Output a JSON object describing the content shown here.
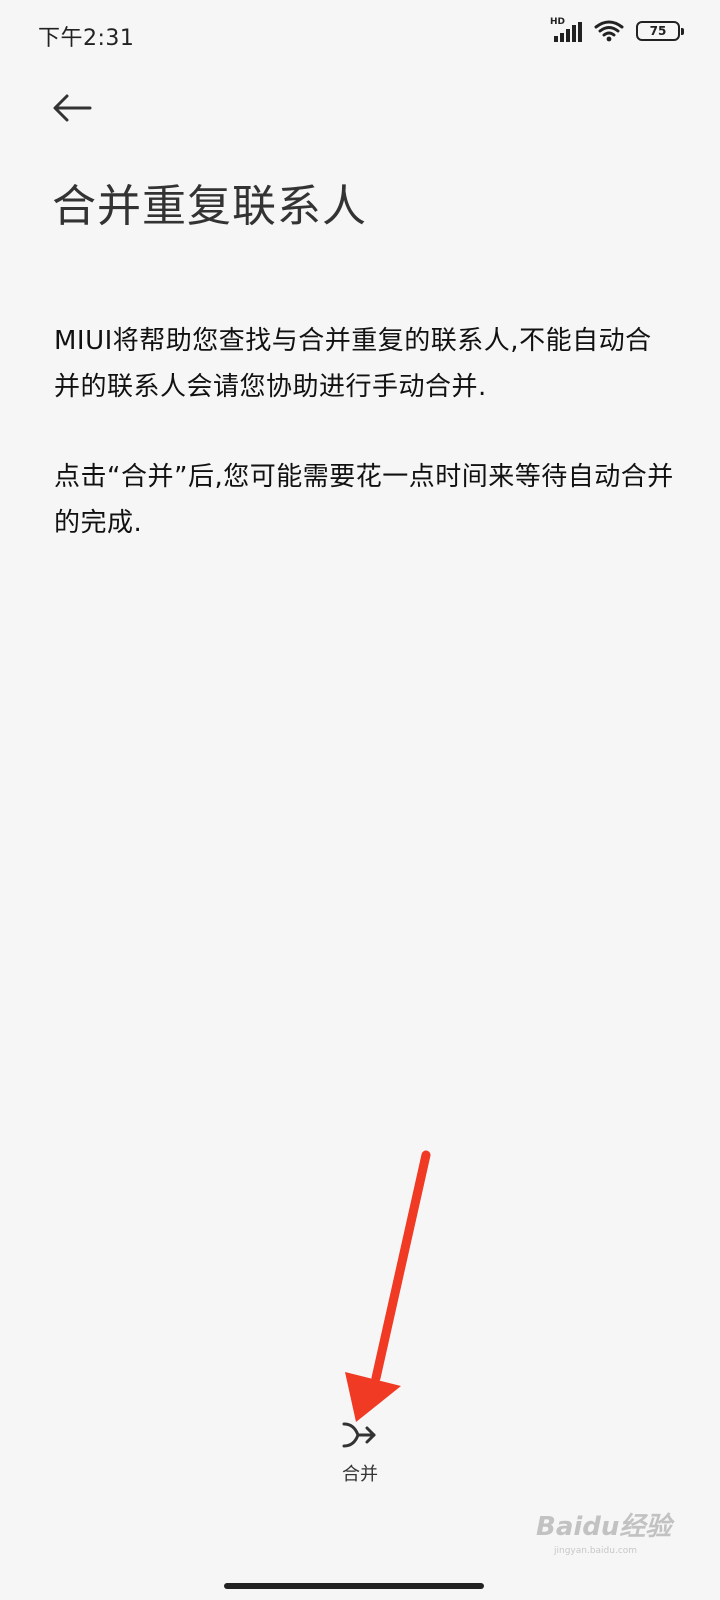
{
  "status_bar": {
    "time": "下午2:31",
    "network_label": "HD",
    "battery_level": "75"
  },
  "header": {
    "back_icon": "back-arrow-icon",
    "title": "合并重复联系人"
  },
  "body": {
    "paragraph_1": "MIUI将帮助您查找与合并重复的联系人,不能自动合并的联系人会请您协助进行手动合并.",
    "paragraph_2": "点击“合并”后,您可能需要花一点时间来等待自动合并的完成."
  },
  "footer": {
    "merge_icon": "merge-icon",
    "merge_label": "合并"
  },
  "annotation": {
    "arrow_color": "#f03a24"
  },
  "watermark": {
    "text": "Baidu经验",
    "url": "jingyan.baidu.com"
  }
}
